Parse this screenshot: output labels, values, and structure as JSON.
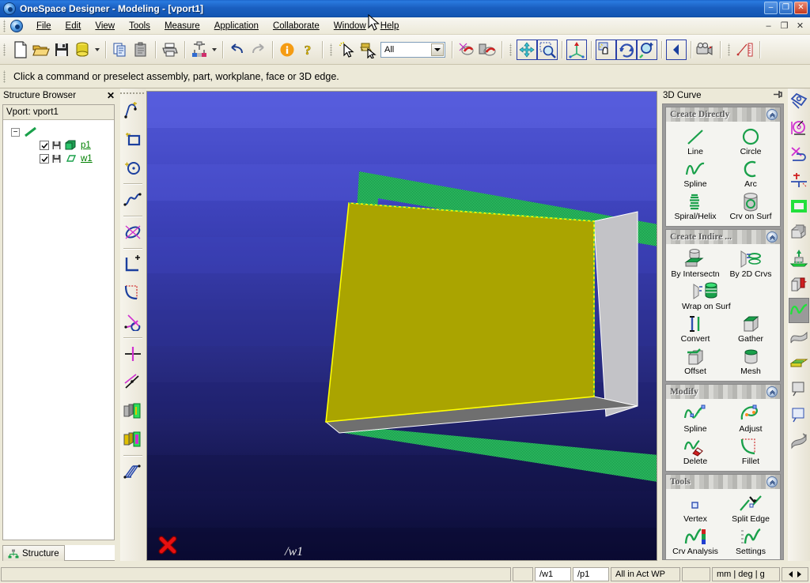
{
  "window": {
    "title": "OneSpace Designer - Modeling - [vport1]",
    "app_icon": "gear-icon",
    "minimize": "–",
    "maximize": "❐",
    "close": "✕",
    "mdi_minimize": "–",
    "mdi_restore": "❐",
    "mdi_close": "✕"
  },
  "menu": {
    "items": [
      {
        "label": "File"
      },
      {
        "label": "Edit"
      },
      {
        "label": "View"
      },
      {
        "label": "Tools"
      },
      {
        "label": "Measure"
      },
      {
        "label": "Application"
      },
      {
        "label": "Collaborate"
      },
      {
        "label": "Window"
      },
      {
        "label": "Help"
      }
    ]
  },
  "toolbar": {
    "buttons": [
      {
        "name": "new-file-icon",
        "title": "New"
      },
      {
        "name": "open-file-icon",
        "title": "Open"
      },
      {
        "name": "save-icon",
        "title": "Save"
      },
      {
        "name": "database-icon",
        "title": "Catalog"
      },
      {
        "name": "copy-icon",
        "title": "Copy"
      },
      {
        "name": "paste-icon",
        "title": "Paste"
      },
      {
        "name": "print-icon",
        "title": "Print"
      },
      {
        "name": "assembly-icon",
        "title": "Assembly"
      },
      {
        "name": "undo-icon",
        "title": "Undo"
      },
      {
        "name": "redo-icon",
        "title": "Redo"
      },
      {
        "name": "info-icon",
        "title": "Info"
      },
      {
        "name": "help-icon",
        "title": "Help"
      },
      {
        "name": "select-pointer-icon",
        "title": "Select"
      },
      {
        "name": "select-box-icon",
        "title": "Select Box"
      },
      {
        "name": "magnet-icon",
        "title": "Snap"
      },
      {
        "name": "deselect-icon",
        "title": "Deselect"
      },
      {
        "name": "fit-view-icon",
        "title": "Fit"
      },
      {
        "name": "zoom-window-icon",
        "title": "Zoom Window"
      },
      {
        "name": "axis-icon",
        "title": "Axis"
      },
      {
        "name": "pan-icon",
        "title": "Pan"
      },
      {
        "name": "rotate-icon",
        "title": "Rotate"
      },
      {
        "name": "zoom-in-icon",
        "title": "Zoom In"
      },
      {
        "name": "prev-view-icon",
        "title": "Previous View"
      },
      {
        "name": "camera-icon",
        "title": "Camera"
      },
      {
        "name": "measure-icon",
        "title": "Measure"
      }
    ],
    "filter_combo_value": "All"
  },
  "prompt": {
    "message": "Click a command or preselect assembly, part, workplane, face or 3D edge."
  },
  "structure_browser": {
    "title": "Structure Browser",
    "close_label": "✕",
    "vport_label": "Vport: vport1",
    "root_expander": "−",
    "nodes": [
      {
        "label": "p1",
        "checked": true,
        "icon": "part-icon"
      },
      {
        "label": "w1",
        "checked": true,
        "icon": "workplane-icon"
      }
    ],
    "tab_label": "Structure"
  },
  "viewport": {
    "workplane_label": "/w1",
    "origin_marker": "red-x-marker",
    "background_top_color": "#4a51cf",
    "background_bottom_color": "#0a0a3c",
    "face_top_color": "#aaa400",
    "face_side_color": "#c8c8cc",
    "face_bottom_color": "#6e6e6e",
    "workplane_color": "#1f9c52",
    "highlight_edge_color": "#ffff00"
  },
  "curve_panel": {
    "title": "3D Curve",
    "pin_icon": "pin-icon",
    "groups": [
      {
        "title": "Create Directly",
        "collapse_icon": "chevron-up-icon",
        "commands": [
          {
            "label": "Line",
            "icon": "line-icon"
          },
          {
            "label": "Circle",
            "icon": "circle-icon"
          },
          {
            "label": "Spline",
            "icon": "spline-icon"
          },
          {
            "label": "Arc",
            "icon": "arc-icon"
          },
          {
            "label": "Spiral/Helix",
            "icon": "spiral-helix-icon"
          },
          {
            "label": "Crv on Surf",
            "icon": "curve-on-surface-icon"
          }
        ]
      },
      {
        "title": "Create Indire  ...",
        "collapse_icon": "chevron-up-icon",
        "commands": [
          {
            "label": "By Intersectn",
            "icon": "by-intersection-icon"
          },
          {
            "label": "By 2D Crvs",
            "icon": "by-2d-curves-icon"
          },
          {
            "label": "Wrap on Surf",
            "icon": "wrap-on-surface-icon"
          },
          {
            "label": "Convert",
            "icon": "convert-icon"
          },
          {
            "label": "Gather",
            "icon": "gather-icon"
          },
          {
            "label": "Offset",
            "icon": "offset-icon"
          },
          {
            "label": "Mesh",
            "icon": "mesh-icon"
          }
        ]
      },
      {
        "title": "Modify",
        "collapse_icon": "chevron-up-icon",
        "commands": [
          {
            "label": "Spline",
            "icon": "modify-spline-icon"
          },
          {
            "label": "Adjust",
            "icon": "adjust-icon"
          },
          {
            "label": "Delete",
            "icon": "delete-icon"
          },
          {
            "label": "Fillet",
            "icon": "fillet-icon"
          }
        ]
      },
      {
        "title": "Tools",
        "collapse_icon": "chevron-up-icon",
        "commands": [
          {
            "label": "Vertex",
            "icon": "vertex-icon"
          },
          {
            "label": "Split Edge",
            "icon": "split-edge-icon"
          },
          {
            "label": "Crv Analysis",
            "icon": "curve-analysis-icon"
          },
          {
            "label": "Settings",
            "icon": "settings-icon"
          }
        ]
      }
    ]
  },
  "side_rail": {
    "items": [
      {
        "name": "sketch-plane-icon",
        "selected": false
      },
      {
        "name": "circle-construct-icon",
        "selected": false
      },
      {
        "name": "curve-2d-icon",
        "selected": false
      },
      {
        "name": "dimension-icon",
        "selected": false
      },
      {
        "name": "surface-square-icon",
        "selected": false
      },
      {
        "name": "solid-feature-icon",
        "selected": false
      },
      {
        "name": "extrude-icon",
        "selected": false
      },
      {
        "name": "box-cut-icon",
        "selected": false
      },
      {
        "name": "curve-3d-icon",
        "selected": true
      },
      {
        "name": "surface-icon",
        "selected": false
      },
      {
        "name": "sheet-metal-icon",
        "selected": false
      },
      {
        "name": "annotation-icon",
        "selected": false
      },
      {
        "name": "drawing-icon",
        "selected": false
      },
      {
        "name": "render-icon",
        "selected": false
      }
    ]
  },
  "left_rail": {
    "items": [
      {
        "name": "polyline-2d-icon"
      },
      {
        "name": "rectangle-icon"
      },
      {
        "name": "circle-2d-icon"
      },
      {
        "name": "spline-2d-icon"
      },
      {
        "name": "ellipse-icon"
      },
      {
        "name": "corner-icon"
      },
      {
        "name": "fillet-2d-icon"
      },
      {
        "name": "trim-icon"
      },
      {
        "name": "center-line-icon"
      },
      {
        "name": "offset-2d-icon"
      },
      {
        "name": "extrude-profile-icon"
      },
      {
        "name": "extrude-profile2-icon"
      },
      {
        "name": "sweep-icon"
      }
    ]
  },
  "status_bar": {
    "cells": [
      {
        "value": "/w1",
        "style": "white"
      },
      {
        "value": "/p1",
        "style": "white"
      },
      {
        "value": "All in Act WP",
        "style": "normal"
      },
      {
        "value": "",
        "style": "normal"
      },
      {
        "value": "mm | deg | g",
        "style": "normal"
      }
    ],
    "nav_prev": "◄",
    "nav_next": "►"
  }
}
